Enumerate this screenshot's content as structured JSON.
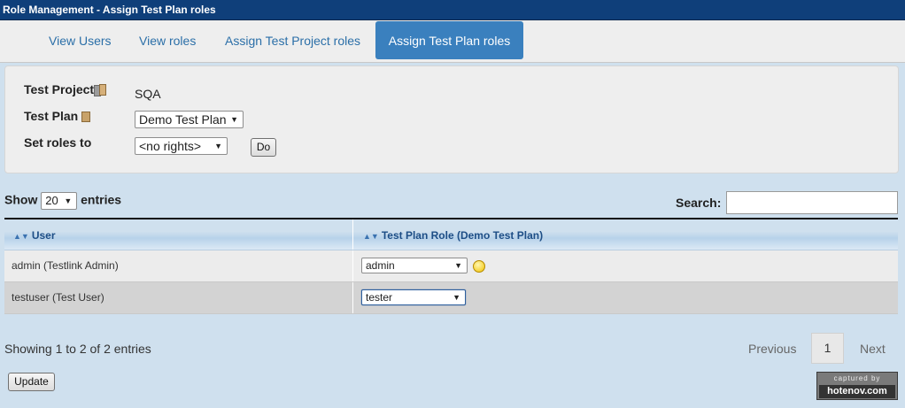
{
  "window": {
    "title": "Role Management - Assign Test Plan roles"
  },
  "tabs": [
    {
      "label": "View Users"
    },
    {
      "label": "View roles"
    },
    {
      "label": "Assign Test Project roles"
    },
    {
      "label": "Assign Test Plan roles",
      "active": true
    }
  ],
  "form": {
    "test_project_label": "Test Project",
    "test_project_value": "SQA",
    "test_plan_label": "Test Plan",
    "test_plan_selected": "Demo Test Plan",
    "set_roles_label": "Set roles to",
    "set_roles_selected": "<no rights>",
    "do_button": "Do"
  },
  "table_controls": {
    "show_label": "Show",
    "entries_selected": "20",
    "entries_label": "entries",
    "search_label": "Search:",
    "search_value": ""
  },
  "table": {
    "columns": [
      "User",
      "Test Plan Role (Demo Test Plan)"
    ],
    "rows": [
      {
        "user": "admin (Testlink Admin)",
        "role": "admin"
      },
      {
        "user": "testuser (Test User)",
        "role": "tester"
      }
    ]
  },
  "footer": {
    "info": "Showing 1 to 2 of 2 entries",
    "previous": "Previous",
    "page": "1",
    "next": "Next",
    "update_button": "Update"
  },
  "watermark": {
    "line1": "captured by",
    "line2": "hotenov.com"
  },
  "colors": {
    "title_bar": "#0f3f7a",
    "active_tab": "#3a80be",
    "link": "#2b6fa8",
    "background": "#cfe0ee"
  },
  "icons": [
    "test-project-book-icon",
    "test-plan-book-icon",
    "sort-icon",
    "lightbulb-icon",
    "dropdown-arrow-icon"
  ]
}
